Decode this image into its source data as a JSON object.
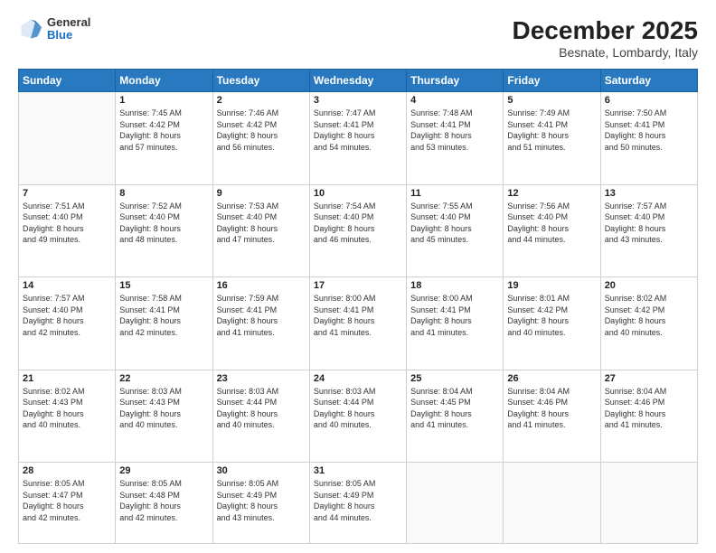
{
  "header": {
    "logo": {
      "general": "General",
      "blue": "Blue"
    },
    "title": "December 2025",
    "location": "Besnate, Lombardy, Italy"
  },
  "days_of_week": [
    "Sunday",
    "Monday",
    "Tuesday",
    "Wednesday",
    "Thursday",
    "Friday",
    "Saturday"
  ],
  "weeks": [
    [
      {
        "day": "",
        "info": ""
      },
      {
        "day": "1",
        "info": "Sunrise: 7:45 AM\nSunset: 4:42 PM\nDaylight: 8 hours\nand 57 minutes."
      },
      {
        "day": "2",
        "info": "Sunrise: 7:46 AM\nSunset: 4:42 PM\nDaylight: 8 hours\nand 56 minutes."
      },
      {
        "day": "3",
        "info": "Sunrise: 7:47 AM\nSunset: 4:41 PM\nDaylight: 8 hours\nand 54 minutes."
      },
      {
        "day": "4",
        "info": "Sunrise: 7:48 AM\nSunset: 4:41 PM\nDaylight: 8 hours\nand 53 minutes."
      },
      {
        "day": "5",
        "info": "Sunrise: 7:49 AM\nSunset: 4:41 PM\nDaylight: 8 hours\nand 51 minutes."
      },
      {
        "day": "6",
        "info": "Sunrise: 7:50 AM\nSunset: 4:41 PM\nDaylight: 8 hours\nand 50 minutes."
      }
    ],
    [
      {
        "day": "7",
        "info": "Sunrise: 7:51 AM\nSunset: 4:40 PM\nDaylight: 8 hours\nand 49 minutes."
      },
      {
        "day": "8",
        "info": "Sunrise: 7:52 AM\nSunset: 4:40 PM\nDaylight: 8 hours\nand 48 minutes."
      },
      {
        "day": "9",
        "info": "Sunrise: 7:53 AM\nSunset: 4:40 PM\nDaylight: 8 hours\nand 47 minutes."
      },
      {
        "day": "10",
        "info": "Sunrise: 7:54 AM\nSunset: 4:40 PM\nDaylight: 8 hours\nand 46 minutes."
      },
      {
        "day": "11",
        "info": "Sunrise: 7:55 AM\nSunset: 4:40 PM\nDaylight: 8 hours\nand 45 minutes."
      },
      {
        "day": "12",
        "info": "Sunrise: 7:56 AM\nSunset: 4:40 PM\nDaylight: 8 hours\nand 44 minutes."
      },
      {
        "day": "13",
        "info": "Sunrise: 7:57 AM\nSunset: 4:40 PM\nDaylight: 8 hours\nand 43 minutes."
      }
    ],
    [
      {
        "day": "14",
        "info": "Sunrise: 7:57 AM\nSunset: 4:40 PM\nDaylight: 8 hours\nand 42 minutes."
      },
      {
        "day": "15",
        "info": "Sunrise: 7:58 AM\nSunset: 4:41 PM\nDaylight: 8 hours\nand 42 minutes."
      },
      {
        "day": "16",
        "info": "Sunrise: 7:59 AM\nSunset: 4:41 PM\nDaylight: 8 hours\nand 41 minutes."
      },
      {
        "day": "17",
        "info": "Sunrise: 8:00 AM\nSunset: 4:41 PM\nDaylight: 8 hours\nand 41 minutes."
      },
      {
        "day": "18",
        "info": "Sunrise: 8:00 AM\nSunset: 4:41 PM\nDaylight: 8 hours\nand 41 minutes."
      },
      {
        "day": "19",
        "info": "Sunrise: 8:01 AM\nSunset: 4:42 PM\nDaylight: 8 hours\nand 40 minutes."
      },
      {
        "day": "20",
        "info": "Sunrise: 8:02 AM\nSunset: 4:42 PM\nDaylight: 8 hours\nand 40 minutes."
      }
    ],
    [
      {
        "day": "21",
        "info": "Sunrise: 8:02 AM\nSunset: 4:43 PM\nDaylight: 8 hours\nand 40 minutes."
      },
      {
        "day": "22",
        "info": "Sunrise: 8:03 AM\nSunset: 4:43 PM\nDaylight: 8 hours\nand 40 minutes."
      },
      {
        "day": "23",
        "info": "Sunrise: 8:03 AM\nSunset: 4:44 PM\nDaylight: 8 hours\nand 40 minutes."
      },
      {
        "day": "24",
        "info": "Sunrise: 8:03 AM\nSunset: 4:44 PM\nDaylight: 8 hours\nand 40 minutes."
      },
      {
        "day": "25",
        "info": "Sunrise: 8:04 AM\nSunset: 4:45 PM\nDaylight: 8 hours\nand 41 minutes."
      },
      {
        "day": "26",
        "info": "Sunrise: 8:04 AM\nSunset: 4:46 PM\nDaylight: 8 hours\nand 41 minutes."
      },
      {
        "day": "27",
        "info": "Sunrise: 8:04 AM\nSunset: 4:46 PM\nDaylight: 8 hours\nand 41 minutes."
      }
    ],
    [
      {
        "day": "28",
        "info": "Sunrise: 8:05 AM\nSunset: 4:47 PM\nDaylight: 8 hours\nand 42 minutes."
      },
      {
        "day": "29",
        "info": "Sunrise: 8:05 AM\nSunset: 4:48 PM\nDaylight: 8 hours\nand 42 minutes."
      },
      {
        "day": "30",
        "info": "Sunrise: 8:05 AM\nSunset: 4:49 PM\nDaylight: 8 hours\nand 43 minutes."
      },
      {
        "day": "31",
        "info": "Sunrise: 8:05 AM\nSunset: 4:49 PM\nDaylight: 8 hours\nand 44 minutes."
      },
      {
        "day": "",
        "info": ""
      },
      {
        "day": "",
        "info": ""
      },
      {
        "day": "",
        "info": ""
      }
    ]
  ]
}
